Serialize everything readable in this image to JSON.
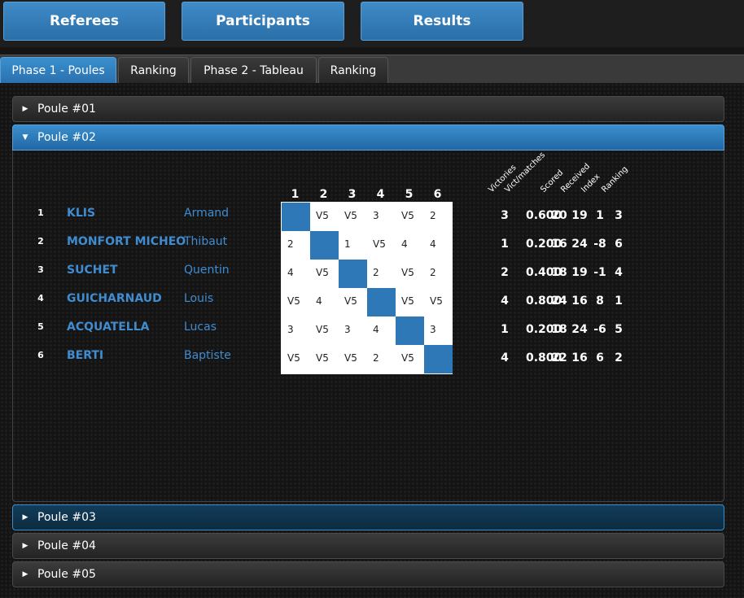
{
  "nav": {
    "buttons": [
      "Referees",
      "Participants",
      "Results"
    ]
  },
  "tabs": [
    "Phase 1 - Poules",
    "Ranking",
    "Phase 2 - Tableau",
    "Ranking"
  ],
  "poules": [
    "Poule #01",
    "Poule #02",
    "Poule #03",
    "Poule #04",
    "Poule #05"
  ],
  "matrix_cols": [
    "1",
    "2",
    "3",
    "4",
    "5",
    "6"
  ],
  "stat_headers": [
    "Victories",
    "Vict/matches",
    "Scored",
    "Received",
    "Index",
    "Ranking"
  ],
  "fencers": [
    {
      "num": "1",
      "last": "KLIS",
      "first": "Armand",
      "bouts": [
        "",
        "V5",
        "V5",
        "3",
        "V5",
        "2"
      ],
      "victories": "3",
      "ratio": "0.600",
      "scored": "20",
      "received": "19",
      "index": "1",
      "ranking": "3"
    },
    {
      "num": "2",
      "last": "MONFORT MICHEO",
      "first": "Thibaut",
      "bouts": [
        "2",
        "",
        "1",
        "V5",
        "4",
        "4"
      ],
      "victories": "1",
      "ratio": "0.200",
      "scored": "16",
      "received": "24",
      "index": "-8",
      "ranking": "6"
    },
    {
      "num": "3",
      "last": "SUCHET",
      "first": "Quentin",
      "bouts": [
        "4",
        "V5",
        "",
        "2",
        "V5",
        "2"
      ],
      "victories": "2",
      "ratio": "0.400",
      "scored": "18",
      "received": "19",
      "index": "-1",
      "ranking": "4"
    },
    {
      "num": "4",
      "last": "GUICHARNAUD",
      "first": "Louis",
      "bouts": [
        "V5",
        "4",
        "V5",
        "",
        "V5",
        "V5"
      ],
      "victories": "4",
      "ratio": "0.800",
      "scored": "24",
      "received": "16",
      "index": "8",
      "ranking": "1"
    },
    {
      "num": "5",
      "last": "ACQUATELLA",
      "first": "Lucas",
      "bouts": [
        "3",
        "V5",
        "3",
        "4",
        "",
        "3"
      ],
      "victories": "1",
      "ratio": "0.200",
      "scored": "18",
      "received": "24",
      "index": "-6",
      "ranking": "5"
    },
    {
      "num": "6",
      "last": "BERTI",
      "first": "Baptiste",
      "bouts": [
        "V5",
        "V5",
        "V5",
        "2",
        "V5",
        ""
      ],
      "victories": "4",
      "ratio": "0.800",
      "scored": "22",
      "received": "16",
      "index": "6",
      "ranking": "2"
    }
  ],
  "colors": {
    "accent": "#2e78b7",
    "name_text": "#3f8cd0"
  }
}
